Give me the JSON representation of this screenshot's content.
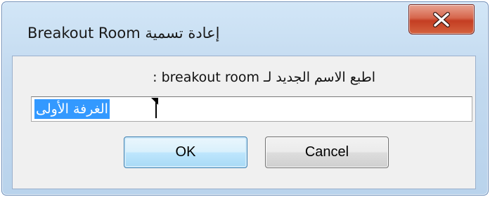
{
  "window": {
    "title": "إعادة تسمية Breakout Room"
  },
  "titlebar": {
    "close_icon": "close-x-icon"
  },
  "dialog": {
    "prompt": "اطبع الاسم الجديد لـ breakout room :",
    "input_value": "الغرفة الأولى",
    "ok_label": "OK",
    "cancel_label": "Cancel"
  },
  "colors": {
    "frame": "#c2d9ef",
    "close_button": "#c43d22",
    "selection": "#3399ff",
    "default_button_border": "#3c7fb1"
  }
}
